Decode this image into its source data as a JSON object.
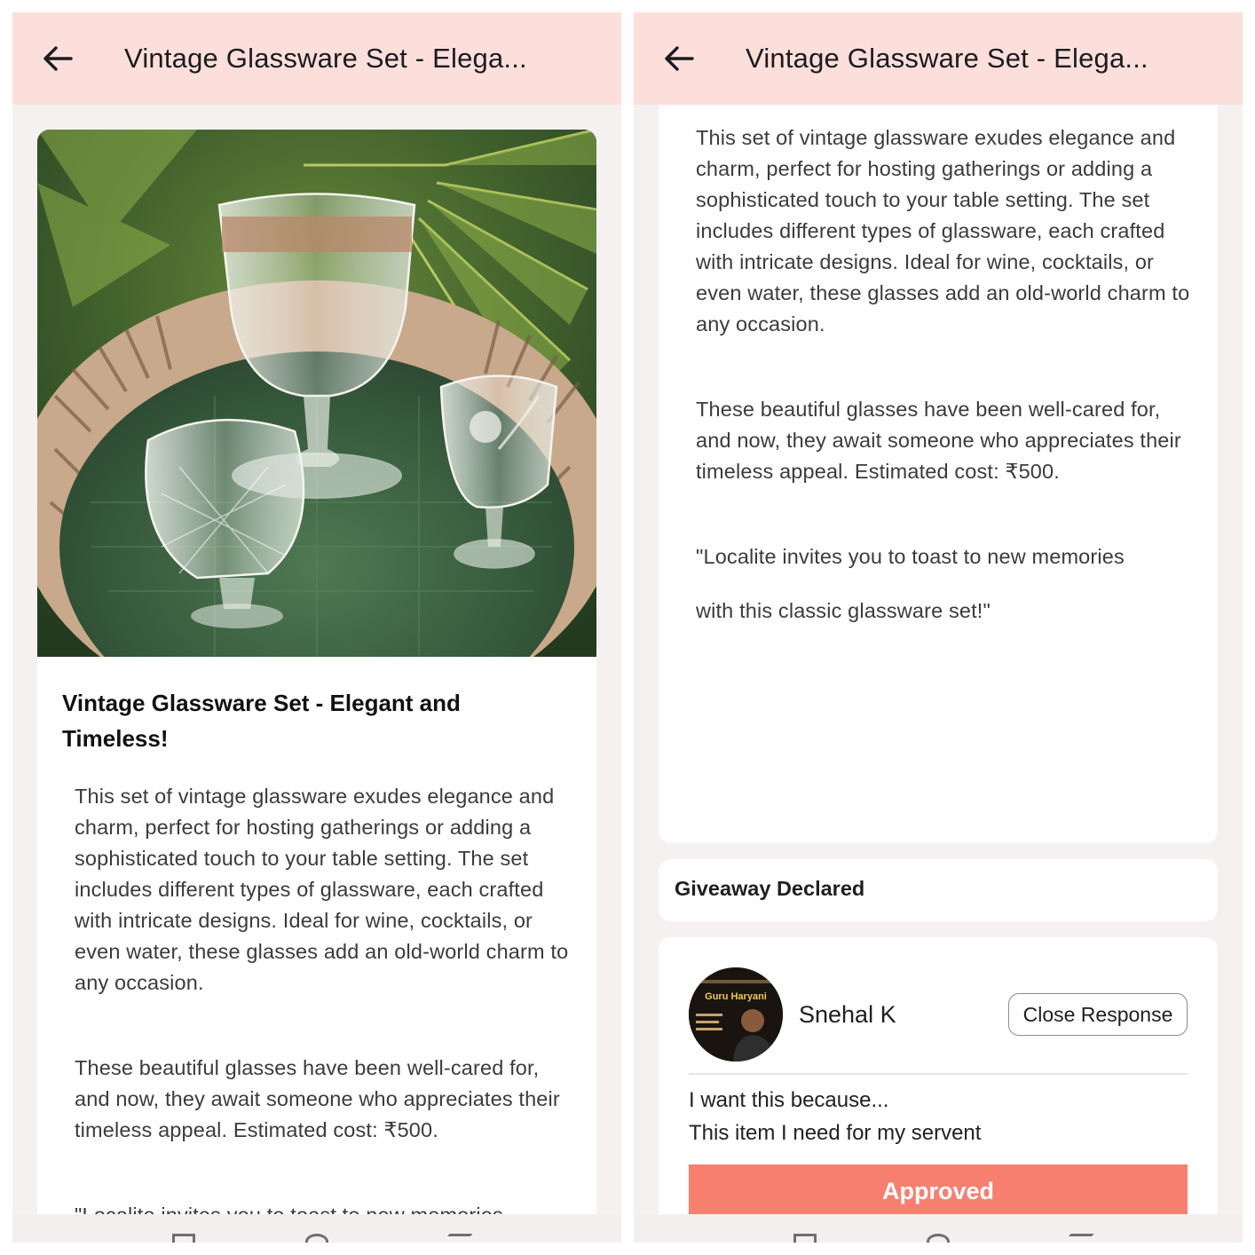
{
  "left_screen": {
    "app_bar": {
      "title": "Vintage Glassware Set - Elega..."
    },
    "listing": {
      "title": "Vintage Glassware Set - Elegant and Timeless!",
      "paragraph1": "This set of vintage glassware exudes elegance and charm, perfect for hosting gatherings or adding a sophisticated touch to your table setting. The set includes different types of glassware, each crafted with intricate designs. Ideal for wine, cocktails, or even water, these glasses add an old-world charm to any occasion.",
      "paragraph2": "These beautiful glasses have been well-cared for, and now, they await someone who appreciates their timeless appeal. Estimated cost: ₹500.",
      "paragraph3_partial": "\"Localite invites you to toast to new memories"
    }
  },
  "right_screen": {
    "app_bar": {
      "title": "Vintage Glassware Set - Elega..."
    },
    "description": {
      "paragraph1": "This set of vintage glassware exudes elegance and charm, perfect for hosting gatherings or adding a sophisticated touch to your table setting. The set includes different types of glassware, each crafted with intricate designs. Ideal for wine, cocktails, or even water, these glasses add an old-world charm to any occasion.",
      "paragraph2": "These beautiful glasses have been well-cared for, and now, they await someone who appreciates their timeless appeal. Estimated cost: ₹500.",
      "quote_line1": "\"Localite invites you to toast to new memories",
      "quote_line2": "with this classic glassware set!\""
    },
    "giveaway": {
      "label": "Giveaway Declared"
    },
    "response": {
      "avatar_text": "Guru Haryani",
      "user_name": "Snehal K",
      "close_button": "Close Response",
      "reason_label": "I want this because...",
      "reason_text": "This item I need for my servent",
      "approved_button": "Approved"
    }
  },
  "colors": {
    "app_bar": "#fcdfdb",
    "background": "#f6f1f1",
    "approved_button": "#f77f70"
  }
}
